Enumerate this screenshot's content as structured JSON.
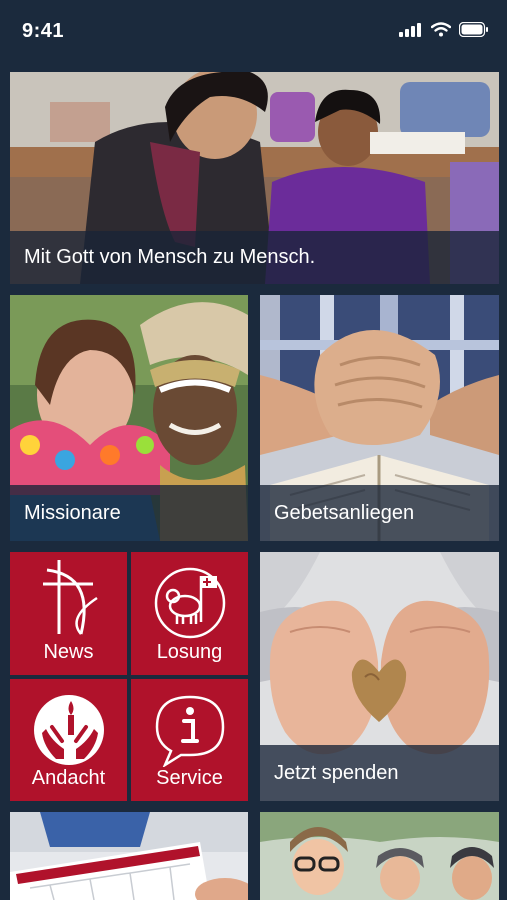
{
  "status_bar": {
    "time": "9:41"
  },
  "tiles": {
    "hero": {
      "caption": "Mit Gott von Mensch zu Mensch."
    },
    "missionare": {
      "caption": "Missionare"
    },
    "gebetsanliegen": {
      "caption": "Gebetsanliegen"
    },
    "news": {
      "label": "News",
      "icon": "cross-arc-icon"
    },
    "losung": {
      "label": "Losung",
      "icon": "lamb-flag-icon"
    },
    "andacht": {
      "label": "Andacht",
      "icon": "hands-candle-icon"
    },
    "service": {
      "label": "Service",
      "icon": "info-bubble-icon"
    },
    "spenden": {
      "caption": "Jetzt spenden"
    }
  },
  "colors": {
    "background": "#1b2a3d",
    "accent": "#b0122b",
    "caption_bar": "#182437"
  }
}
